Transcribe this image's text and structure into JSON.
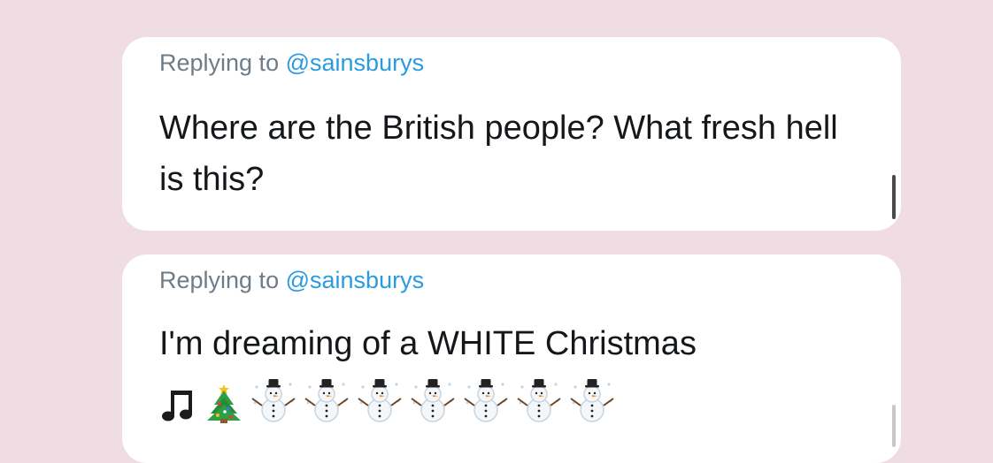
{
  "tweets": [
    {
      "reply_prefix": "Replying to",
      "reply_handle": "@sainsburys",
      "text": "Where are the British people? What fresh hell is this?"
    },
    {
      "reply_prefix": "Replying to",
      "reply_handle": "@sainsburys",
      "text": "I'm dreaming of a WHITE Christmas",
      "emojis": [
        "music-notes-icon",
        "christmas-tree-icon",
        "snowman-icon",
        "snowman-icon",
        "snowman-icon",
        "snowman-icon",
        "snowman-icon",
        "snowman-icon",
        "snowman-icon"
      ]
    }
  ],
  "colors": {
    "background": "#efdde3",
    "card": "#ffffff",
    "handle": "#2a9be0",
    "muted": "#6e7c88",
    "text": "#15181b"
  }
}
